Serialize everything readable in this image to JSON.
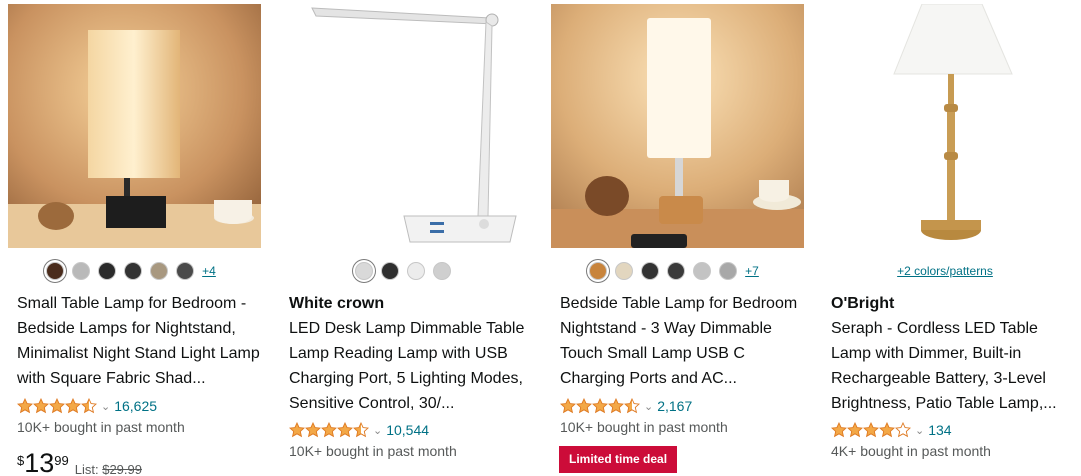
{
  "products": [
    {
      "title": "Small Table Lamp for Bedroom - Bedside Lamps for Nightstand, Minimalist Night Stand Light Lamp with Square Fabric Shad...",
      "more_colors": "+4",
      "rating_count": "16,625",
      "bought": "10K+ bought in past month",
      "price_currency": "$",
      "price_whole": "13",
      "price_fraction": "99",
      "list_label": "List:",
      "list_price": "$29.99"
    },
    {
      "brand": "White crown",
      "title": "LED Desk Lamp Dimmable Table Lamp Reading Lamp with USB Charging Port, 5 Lighting Modes, Sensitive Control, 30/...",
      "rating_count": "10,544",
      "bought": "10K+ bought in past month"
    },
    {
      "title": "Bedside Table Lamp for Bedroom Nightstand - 3 Way Dimmable Touch Small Lamp USB C Charging Ports and AC...",
      "more_colors": "+7",
      "rating_count": "2,167",
      "bought": "10K+ bought in past month",
      "deal_badge": "Limited time deal"
    },
    {
      "brand": "O'Bright",
      "title": "Seraph - Cordless LED Table Lamp with Dimmer, Built-in Rechargeable Battery, 3-Level Brightness, Patio Table Lamp,...",
      "colors_link": "+2 colors/patterns",
      "rating_count": "134",
      "bought": "4K+ bought in past month"
    }
  ],
  "swatch_colors": {
    "p1": [
      "#4a2c1c",
      "#b9b9b9",
      "#2a2a2a",
      "#333333",
      "#a89880",
      "#4a4a4a"
    ],
    "p2": [
      "#d9d9d9",
      "#2f2f2f",
      "#ececec",
      "#cfcfcf"
    ],
    "p3": [
      "#c8843c",
      "#e2d6bf",
      "#333333",
      "#3a3a3a",
      "#c3c3c3",
      "#a8a8a8"
    ]
  },
  "ratings": {
    "p1": 4.5,
    "p2": 4.5,
    "p3": 4.5,
    "p4": 4.0
  },
  "colors": {
    "star": "#f3a847",
    "link": "#007185",
    "deal": "#cc0c39"
  }
}
